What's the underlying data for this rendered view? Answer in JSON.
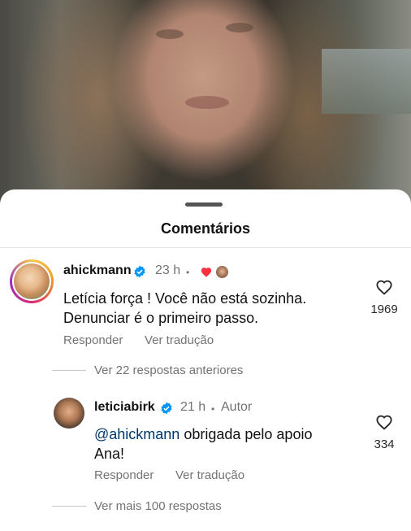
{
  "sheet": {
    "title": "Comentários"
  },
  "comments": [
    {
      "username": "ahickmann",
      "time": "23 h",
      "separator": "•",
      "text": "Letícia força ! Você não está sozinha. Denunciar é o primeiro passo.",
      "text_line1": "Letícia força ! Você não está sozinha.",
      "text_line2": "Denunciar é o primeiro passo.",
      "reply_label": "Responder",
      "translate_label": "Ver tradução",
      "likes": "1969"
    }
  ],
  "replies_prev": {
    "label": "Ver 22 respostas anteriores"
  },
  "reply": {
    "username": "leticiabirk",
    "time": "21 h",
    "separator": "•",
    "author_badge": "Autor",
    "mention": "@ahickmann",
    "text_rest": " obrigada pelo apoio",
    "text_line2": "Ana!",
    "reply_label": "Responder",
    "translate_label": "Ver tradução",
    "likes": "334"
  },
  "replies_more": {
    "label": "Ver mais 100 respostas"
  },
  "colors": {
    "verified": "#0095f6",
    "liked_heart": "#ff3040",
    "secondary_text": "#737373",
    "mention": "#00376b"
  },
  "icons": [
    "verified-badge-icon",
    "heart-outline-icon",
    "heart-filled-icon",
    "sheet-handle"
  ]
}
